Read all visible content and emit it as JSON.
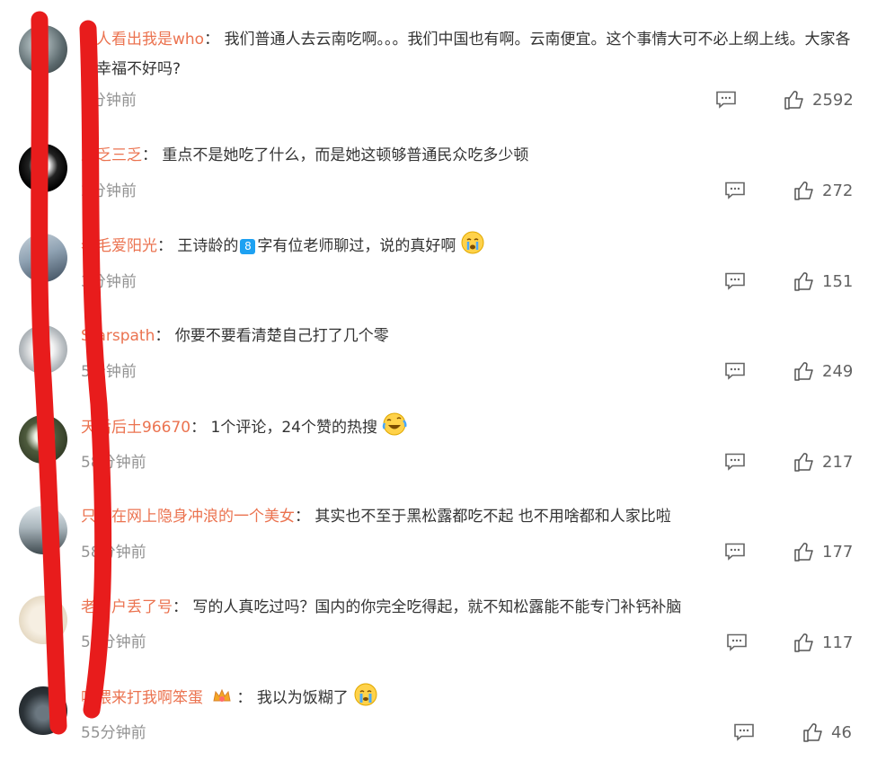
{
  "comments": [
    {
      "username": "让人看出我是who",
      "text": "我们普通人去云南吃啊。。。我们中国也有啊。云南便宜。这个事情大可不必上纲上线。大家各自幸福不好吗?",
      "time": "5分钟前",
      "likes": "2592"
    },
    {
      "username": "王乏三乏",
      "text": "重点不是她吃了什么，而是她这顿够普通民众吃多少顿",
      "time": "2分钟前",
      "likes": "272"
    },
    {
      "username": "老毛爱阳光",
      "text_a": "王诗龄的",
      "badge": "8",
      "text_b": "字有位老师聊过，说的真好啊",
      "time": "3分钟前",
      "likes": "151"
    },
    {
      "username": "Starspath",
      "text": "你要不要看清楚自己打了几个零",
      "time": "5分钟前",
      "likes": "249"
    },
    {
      "username": "天后后土96670",
      "text": "1个评论，24个赞的热搜",
      "time": "58分钟前",
      "likes": "217"
    },
    {
      "username": "只想在网上隐身冲浪的一个美女",
      "text": "其实也不至于黑松露都吃不起 也不用啥都和人家比啦",
      "time": "58分钟前",
      "likes": "177"
    },
    {
      "username": "老用户丢了号",
      "text": "写的人真吃过吗？国内的你完全吃得起，就不知松露能不能专门补钙补脑",
      "time": "56分钟前",
      "likes": "117"
    },
    {
      "username": "喂喂来打我啊笨蛋",
      "text": "我以为饭糊了",
      "time": "55分钟前",
      "likes": "46"
    }
  ],
  "colon": "：",
  "icons": {
    "reply": "comment-icon",
    "like": "thumbs-up-icon"
  },
  "colors": {
    "username": "#eb7350",
    "annotation": "#e81c1c"
  }
}
